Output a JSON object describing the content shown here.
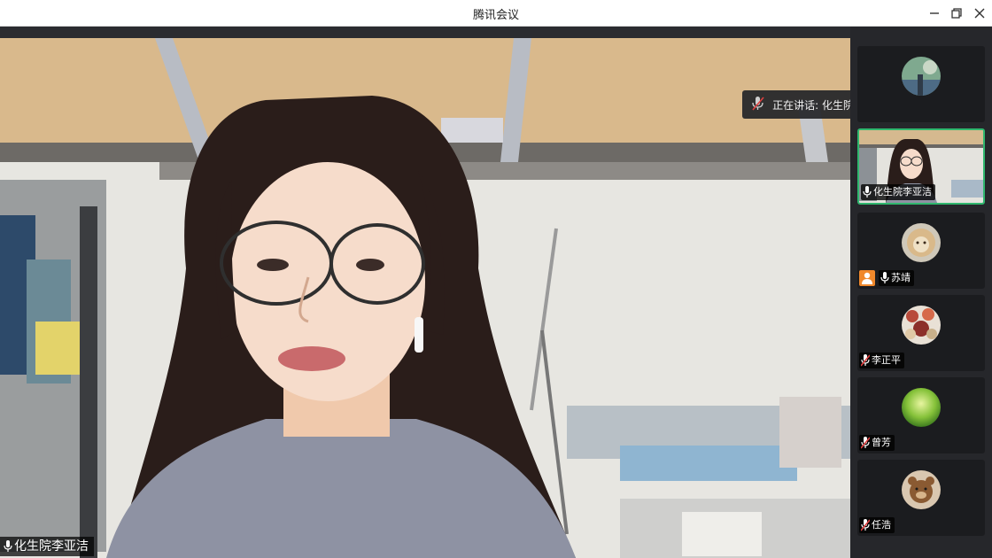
{
  "window": {
    "title": "腾讯会议"
  },
  "main_video": {
    "participant_name": "化生院李亚洁"
  },
  "speaking_banner": {
    "text": "正在讲话: 化生院李亚洁;"
  },
  "participants": [
    {
      "name": "",
      "avatar": "landscape",
      "mic": "none"
    },
    {
      "name": "化生院李亚洁",
      "avatar": "video",
      "mic": "on",
      "active": true
    },
    {
      "name": "苏靖",
      "avatar": "lion",
      "mic": "on",
      "host": true
    },
    {
      "name": "李正平",
      "avatar": "dishes",
      "mic": "muted"
    },
    {
      "name": "曾芳",
      "avatar": "green",
      "mic": "muted"
    },
    {
      "name": "任浩",
      "avatar": "bear",
      "mic": "muted"
    }
  ],
  "colors": {
    "active_border": "#2fb76e",
    "host_badge": "#f0882b",
    "muted_red": "#e04040"
  }
}
